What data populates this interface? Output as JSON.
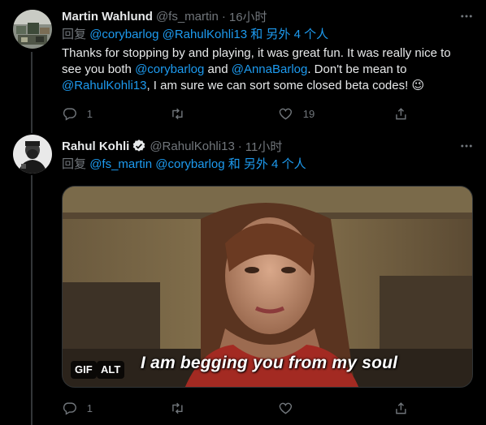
{
  "tweets": [
    {
      "author_name": "Martin Wahlund",
      "handle": "@fs_martin",
      "sep": "·",
      "time": "16小时",
      "reply_prefix": "回复",
      "reply_mention_1": "@corybarlog",
      "reply_mention_2": "@RahulKohli13",
      "reply_suffix": "和 另外 4 个人",
      "body_1": "Thanks for stopping by and playing, it was great fun. It was really nice to see you both ",
      "body_mention_1": "@corybarlog",
      "body_2": " and ",
      "body_mention_2": "@AnnaBarlog",
      "body_3": ". Don't be mean to ",
      "body_mention_3": "@RahulKohli13",
      "body_4": ", I am sure we can sort some closed beta codes! 😉",
      "reply_count": "1",
      "retweet_count": "",
      "like_count": "19"
    },
    {
      "author_name": "Rahul Kohli",
      "handle": "@RahulKohli13",
      "sep": "·",
      "time": "11小时",
      "reply_prefix": "回复",
      "reply_mention_1": "@fs_martin",
      "reply_mention_2": "@corybarlog",
      "reply_suffix": "和 另外 4 个人",
      "media": {
        "caption": "I am begging you from my soul",
        "gif_badge": "GIF",
        "alt_badge": "ALT"
      },
      "reply_count": "1",
      "retweet_count": "",
      "like_count": ""
    }
  ],
  "colors": {
    "background": "#000000",
    "text": "#e7e9ea",
    "muted": "#71767b",
    "link": "#1d9bf0",
    "divider": "#2f3336"
  },
  "icons": [
    "more-icon",
    "verified-icon",
    "reply-icon",
    "retweet-icon",
    "like-icon",
    "share-icon"
  ]
}
